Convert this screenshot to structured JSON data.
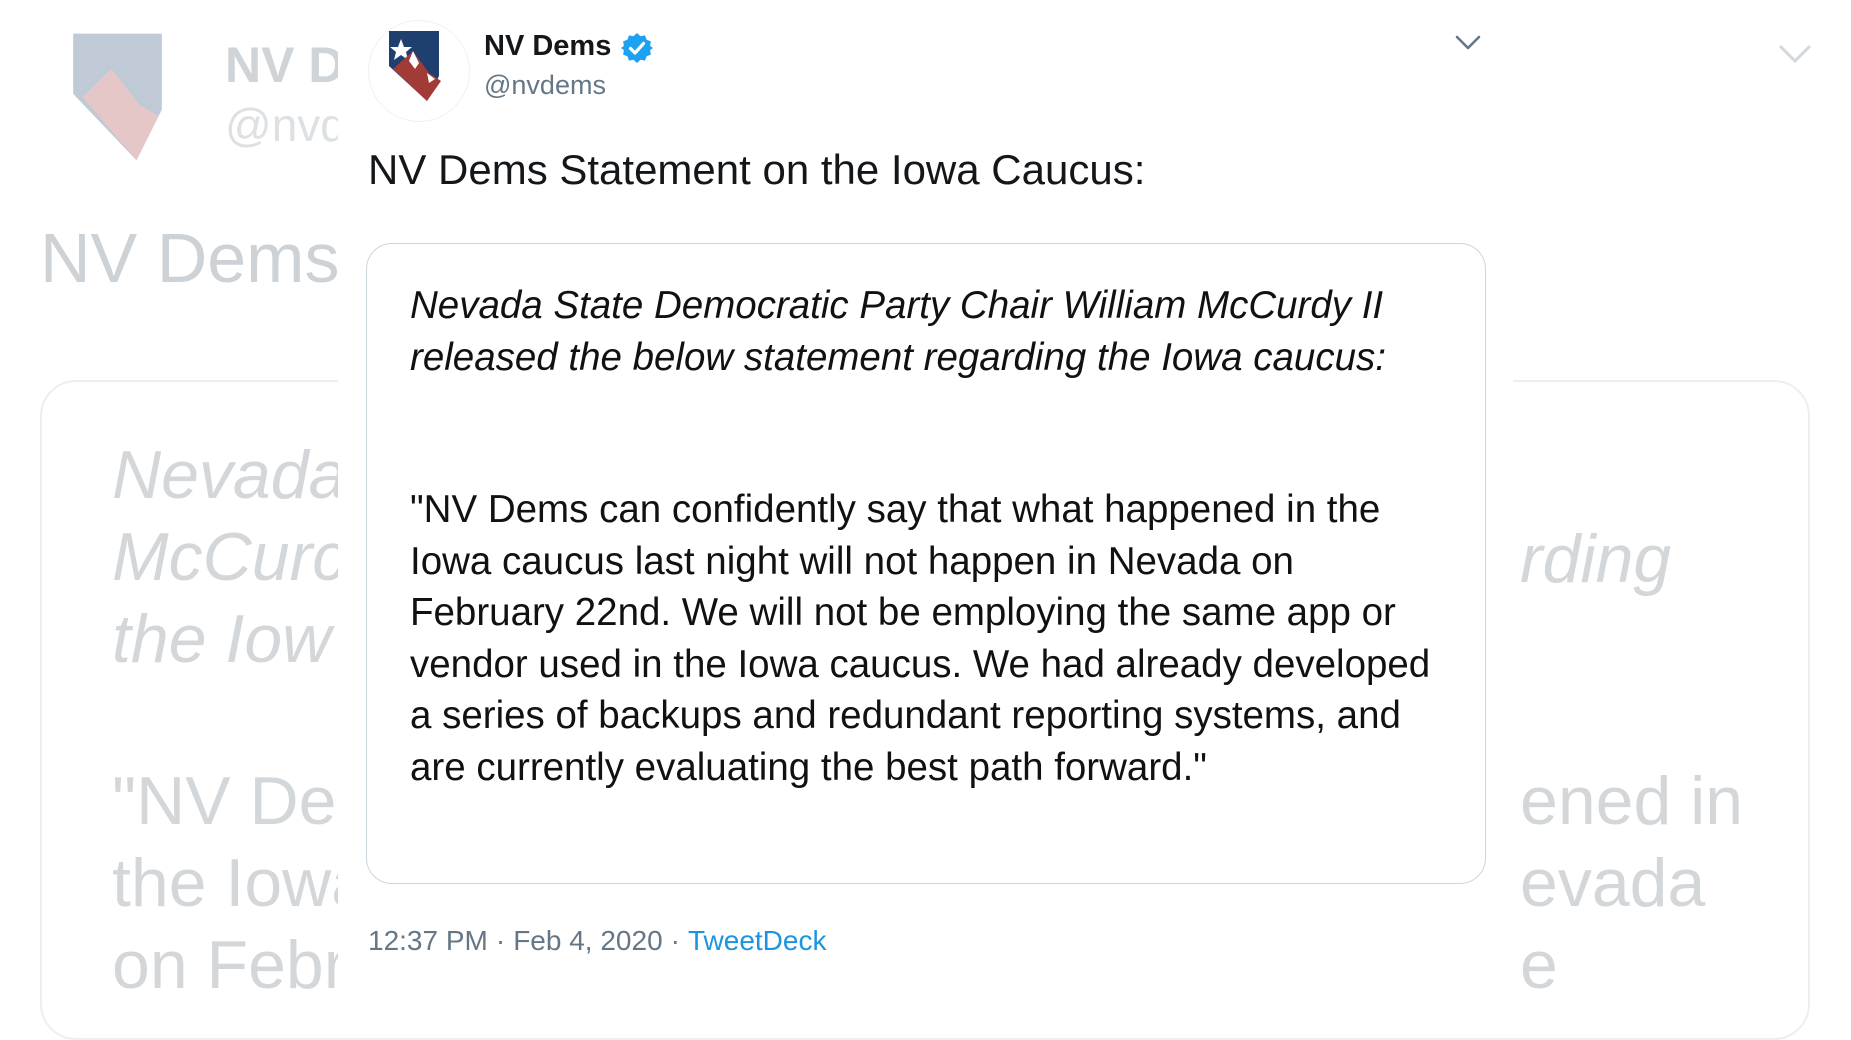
{
  "background": {
    "name_fragment": "NV D",
    "handle_fragment": "@nvd",
    "title_fragment": "NV Dems",
    "intro_fragments": [
      "Nevada",
      "McCurc",
      "the Iow"
    ],
    "quote_fragments": [
      "\"NV De",
      "the Iowa",
      "on Febr"
    ],
    "right_fragments": {
      "intro": "rding",
      "quote": [
        "ened in",
        "evada",
        "e"
      ]
    }
  },
  "tweet": {
    "author": {
      "name": "NV Dems",
      "handle": "@nvdems",
      "verified": true,
      "avatar_icon": "nevada-state-shape-logo"
    },
    "text": "NV Dems Statement on the Iowa Caucus:",
    "statement": {
      "intro": "Nevada State Democratic Party Chair William McCurdy II released the below statement regarding the Iowa caucus:",
      "body": "\"NV Dems can confidently say that what happened in the Iowa caucus last night will not happen in Nevada on February 22nd. We will not be employing the same app or vendor used in the Iowa caucus. We had already developed a series of backups and redundant reporting systems, and are currently evaluating the best path forward.\""
    },
    "time": "12:37 PM",
    "date": "Feb 4, 2020",
    "separator": "·",
    "source": "TweetDeck",
    "caret_icon": "chevron-down-icon"
  },
  "colors": {
    "verified_blue": "#1da1f2",
    "link_blue": "#1b95e0",
    "logo_navy": "#1f3f6e",
    "logo_red": "#a23a35",
    "muted_text": "#657786"
  }
}
